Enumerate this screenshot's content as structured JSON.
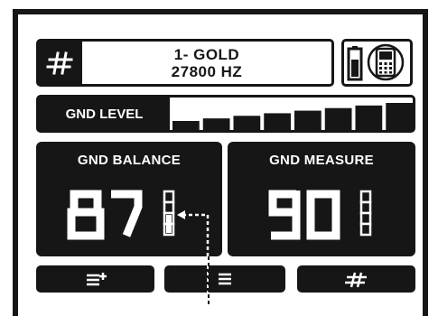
{
  "mode": {
    "icon": "hash-icon",
    "name": "1- GOLD",
    "frequency": "27800 HZ"
  },
  "status": {
    "battery_icon": "battery-icon",
    "device_icon": "detector-icon"
  },
  "gnd_level": {
    "label": "GND LEVEL",
    "segments_total": 8,
    "segments_filled": 8
  },
  "gnd_balance": {
    "title": "GND BALANCE",
    "value": "87"
  },
  "gnd_measure": {
    "title": "GND MEASURE",
    "value": "90"
  },
  "softkeys": [
    {
      "icon": "menu-plus-icon"
    },
    {
      "icon": "menu-icon"
    },
    {
      "icon": "hash-icon"
    }
  ],
  "colors": {
    "foreground": "#161616",
    "background": "#ffffff"
  }
}
